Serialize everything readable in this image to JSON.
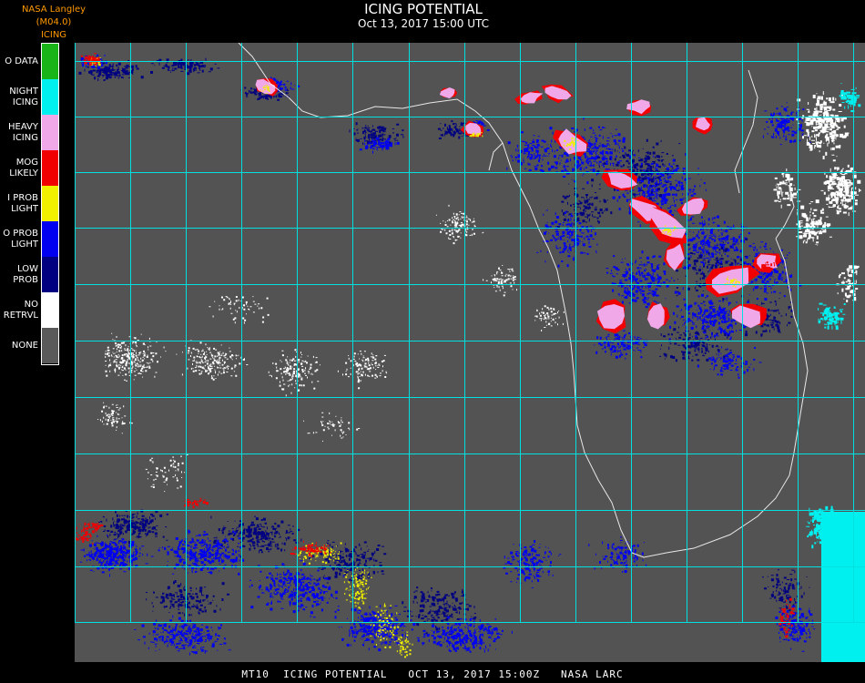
{
  "header": {
    "provider": "NASA Langley (M04.0)",
    "product": "ICING",
    "title": "ICING POTENTIAL",
    "datetime": "Oct 13, 2017 15:00 UTC"
  },
  "legend": [
    {
      "lines": [
        "O DATA"
      ],
      "color": "#18b418"
    },
    {
      "lines": [
        "NIGHT",
        "ICING"
      ],
      "color": "#00f0f0"
    },
    {
      "lines": [
        "HEAVY",
        "ICING"
      ],
      "color": "#f0a8e8"
    },
    {
      "lines": [
        "MOG",
        "LIKELY"
      ],
      "color": "#f00000"
    },
    {
      "lines": [
        "I PROB",
        "LIGHT"
      ],
      "color": "#f0f000"
    },
    {
      "lines": [
        "O PROB",
        "LIGHT"
      ],
      "color": "#0000f0"
    },
    {
      "lines": [
        "LOW",
        "PROB"
      ],
      "color": "#000080"
    },
    {
      "lines": [
        "NO",
        "RETRVL"
      ],
      "color": "#ffffff"
    },
    {
      "lines": [
        "NONE"
      ],
      "color": "#5a5a5a"
    }
  ],
  "colors": {
    "background": "#535353",
    "grid": "#00e0e0",
    "coast": "#e8e8e8",
    "grid_label": "#c81414",
    "header_provider": "#ff9900"
  },
  "footer": {
    "text": "MT10  ICING POTENTIAL   OCT 13, 2017 15:00Z   NASA LARC"
  }
}
